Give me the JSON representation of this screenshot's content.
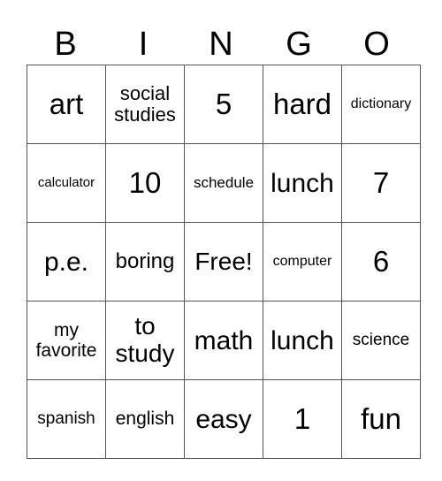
{
  "header": [
    "B",
    "I",
    "N",
    "G",
    "O"
  ],
  "cells": [
    [
      "art",
      "social studies",
      "5",
      "hard",
      "dictionary"
    ],
    [
      "calculator",
      "10",
      "schedule",
      "lunch",
      "7"
    ],
    [
      "p.e.",
      "boring",
      "Free!",
      "computer",
      "6"
    ],
    [
      "my favorite",
      "to study",
      "math",
      "lunch",
      "science"
    ],
    [
      "spanish",
      "english",
      "easy",
      "1",
      "fun"
    ]
  ]
}
